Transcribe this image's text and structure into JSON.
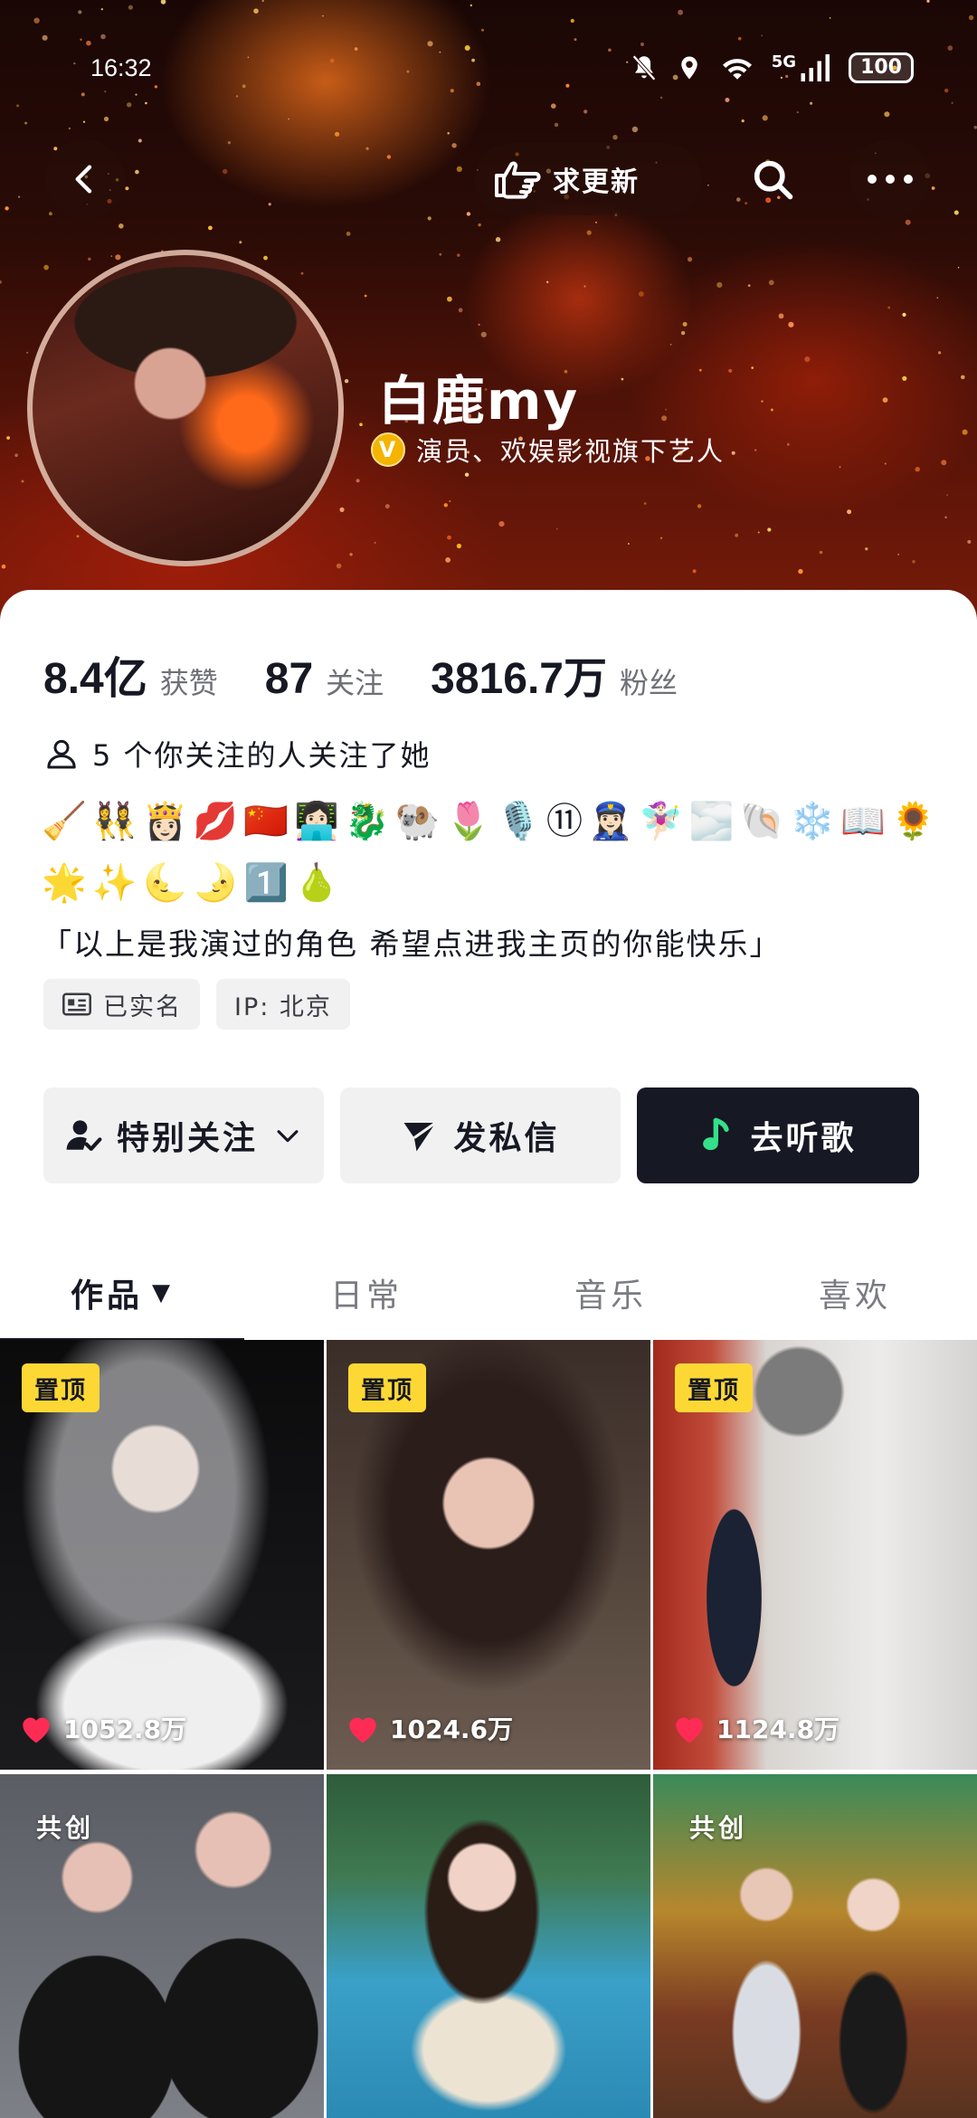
{
  "status_bar": {
    "time": "16:32",
    "network": "5G",
    "battery": "100"
  },
  "header": {
    "update_button_label": "求更新",
    "nickname": "白鹿my",
    "verified_badge": "V",
    "verify_text": "演员、欢娱影视旗下艺人",
    "colors": {
      "banner_dark": "#2a0b06",
      "flame": "#ff6a1a",
      "verify_badge": "#f4b400"
    }
  },
  "stats": [
    {
      "value": "8.4亿",
      "label": "获赞"
    },
    {
      "value": "87",
      "label": "关注"
    },
    {
      "value": "3816.7万",
      "label": "粉丝"
    }
  ],
  "mutual_follow": "5 个你关注的人关注了她",
  "bio": {
    "emoji_line1": "🧹👯‍♀️👸🏻💋🇨🇳👩🏻‍💻🐉🐏🌷🎙️⑪👮🏻‍♀️🧚🏻‍♀️🌫️🐚❄️📖🌻",
    "emoji_line2": "🌟✨🌜🌛1️⃣🍐",
    "text": "「以上是我演过的角色 希望点进我主页的你能快乐」"
  },
  "tags": {
    "real_name": "已实名",
    "ip": "IP: 北京"
  },
  "actions": {
    "special_follow": "特别关注",
    "message": "发私信",
    "listen_music": "去听歌",
    "music_button_color": "#161823"
  },
  "tabs": [
    {
      "label": "作品",
      "active": true
    },
    {
      "label": "日常",
      "active": false
    },
    {
      "label": "音乐",
      "active": false
    },
    {
      "label": "喜欢",
      "active": false
    }
  ],
  "videos": [
    {
      "badge": "置顶",
      "likes": "1052.8万"
    },
    {
      "badge": "置顶",
      "likes": "1024.6万"
    },
    {
      "badge": "置顶",
      "likes": "1124.8万"
    },
    {
      "badge": "共创",
      "likes": ""
    },
    {
      "badge": "",
      "likes": ""
    },
    {
      "badge": "共创",
      "likes": ""
    }
  ],
  "accent_colors": {
    "pin_badge": "#fdd835",
    "like_heart": "#fe2c55"
  }
}
